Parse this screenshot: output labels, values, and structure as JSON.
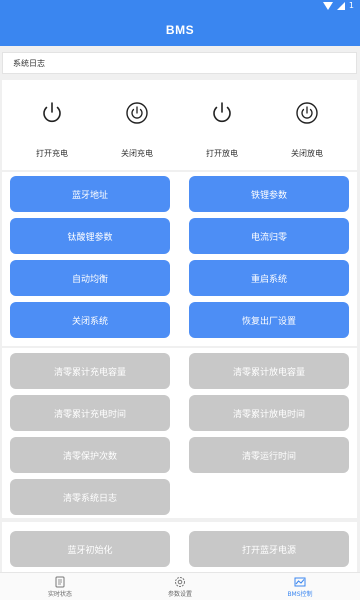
{
  "status_bar": {
    "battery_text": "1"
  },
  "app_bar": {
    "title": "BMS"
  },
  "log": {
    "label": "系统日志"
  },
  "power_controls": [
    {
      "label": "打开充电",
      "icon": "power-icon"
    },
    {
      "label": "关闭充电",
      "icon": "power-circle-icon"
    },
    {
      "label": "打开放电",
      "icon": "power-icon"
    },
    {
      "label": "关闭放电",
      "icon": "power-circle-icon"
    }
  ],
  "blue_buttons": [
    "蓝牙地址",
    "铁锂参数",
    "钛酸锂参数",
    "电流归零",
    "自动均衡",
    "重启系统",
    "关闭系统",
    "恢复出厂设置"
  ],
  "gray_buttons": [
    "清零累计充电容量",
    "清零累计放电容量",
    "清零累计充电时间",
    "清零累计放电时间",
    "清零保护次数",
    "清零运行时间",
    "清零系统日志"
  ],
  "bottom_buttons": [
    "蓝牙初始化",
    "打开蓝牙电源"
  ],
  "nav": [
    {
      "label": "实时状态",
      "icon": "document-icon",
      "active": false
    },
    {
      "label": "参数设置",
      "icon": "gear-icon",
      "active": false
    },
    {
      "label": "BMS控制",
      "icon": "chart-icon",
      "active": true
    }
  ],
  "colors": {
    "primary": "#3a86f0",
    "button_blue": "#4d8ef5",
    "button_gray": "#c8c8c8"
  }
}
